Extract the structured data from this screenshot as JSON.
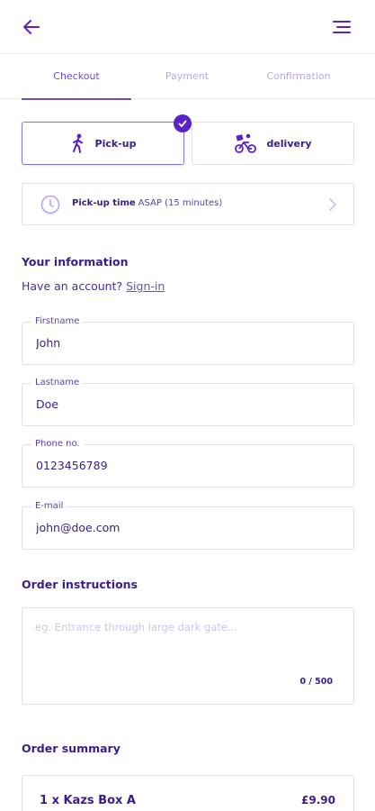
{
  "header": {
    "back_icon": "arrow-left-icon",
    "menu_icon": "hamburger-menu-icon"
  },
  "tabs": [
    {
      "label": "Checkout",
      "active": true
    },
    {
      "label": "Payment",
      "active": false
    },
    {
      "label": "Confirmation",
      "active": false
    }
  ],
  "fulfillment": {
    "options": [
      {
        "label": "Pick-up",
        "icon": "walking-person-icon",
        "selected": true
      },
      {
        "label": "delivery",
        "icon": "bike-delivery-icon",
        "selected": false
      }
    ]
  },
  "pickup_time": {
    "label": "Pick-up time",
    "value": "ASAP (15 minutes)"
  },
  "your_information": {
    "title": "Your information",
    "account_prompt": "Have an account?",
    "sign_in_link": "Sign-in",
    "fields": [
      {
        "label": "Firstname",
        "value": "John"
      },
      {
        "label": "Lastname",
        "value": "Doe"
      },
      {
        "label": "Phone no.",
        "value": "0123456789"
      },
      {
        "label": "E-mail",
        "value": "john@doe.com"
      }
    ]
  },
  "order_instructions": {
    "title": "Order instructions",
    "placeholder": "eg. Entrance through large dark gate...",
    "char_count": "0 / 500"
  },
  "order_summary": {
    "title": "Order summary",
    "items": [
      {
        "name": "1 x Kazs Box A",
        "price": "£9.90"
      }
    ]
  },
  "colors": {
    "accent": "#5a22c8",
    "text_primary": "#3a1d8c",
    "border": "#e3def0",
    "tab_inactive": "#b9a9e6"
  }
}
